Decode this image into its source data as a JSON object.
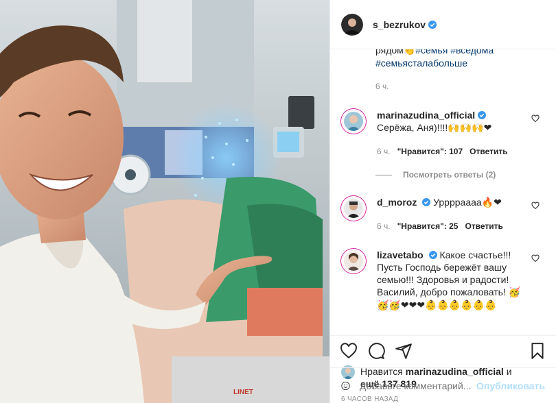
{
  "post": {
    "username": "s_bezrukov",
    "photo_alt": "Selfie in hospital room"
  },
  "caption": {
    "tail_text": "рядом",
    "tail_emoji": "👏",
    "tags": [
      "#семья",
      "#вседома",
      "#семьясталабольше"
    ],
    "time": "6 ч."
  },
  "comments": [
    {
      "username": "marinazudina_official",
      "text": "Серёжа, Аня)!!!!",
      "emoji": "🙌🙌🙌❤",
      "time": "6 ч.",
      "likes_label": "\"Нравится\": 107",
      "reply_label": "Ответить",
      "view_replies": "Посмотреть ответы (2)"
    },
    {
      "username": "d_moroz",
      "text": "Уррррaaaa",
      "emoji": "🔥❤",
      "time": "6 ч.",
      "likes_label": "\"Нравится\": 25",
      "reply_label": "Ответить"
    },
    {
      "username": "lizavetabo",
      "text": "Какое счастье!!! Пусть Господь бережёт вашу семью!!! Здоровья и радости! Василий, добро пожаловать!",
      "emoji": "🥳 🥳🥳❤❤❤👶👶👶👶👶👶"
    }
  ],
  "likes": {
    "prefix": "Нравится",
    "user": "marinazudina_official",
    "middle": "и",
    "more": "ещё 137 819"
  },
  "posted_ago": "6 ЧАСОВ НАЗАД",
  "add_comment": {
    "placeholder": "Добавьте комментарий...",
    "post_label": "Опубликовать"
  },
  "colors": {
    "link": "#00376b",
    "verified": "#3897f0",
    "heart": "#ed4956",
    "post_disabled": "#b2dffc"
  }
}
